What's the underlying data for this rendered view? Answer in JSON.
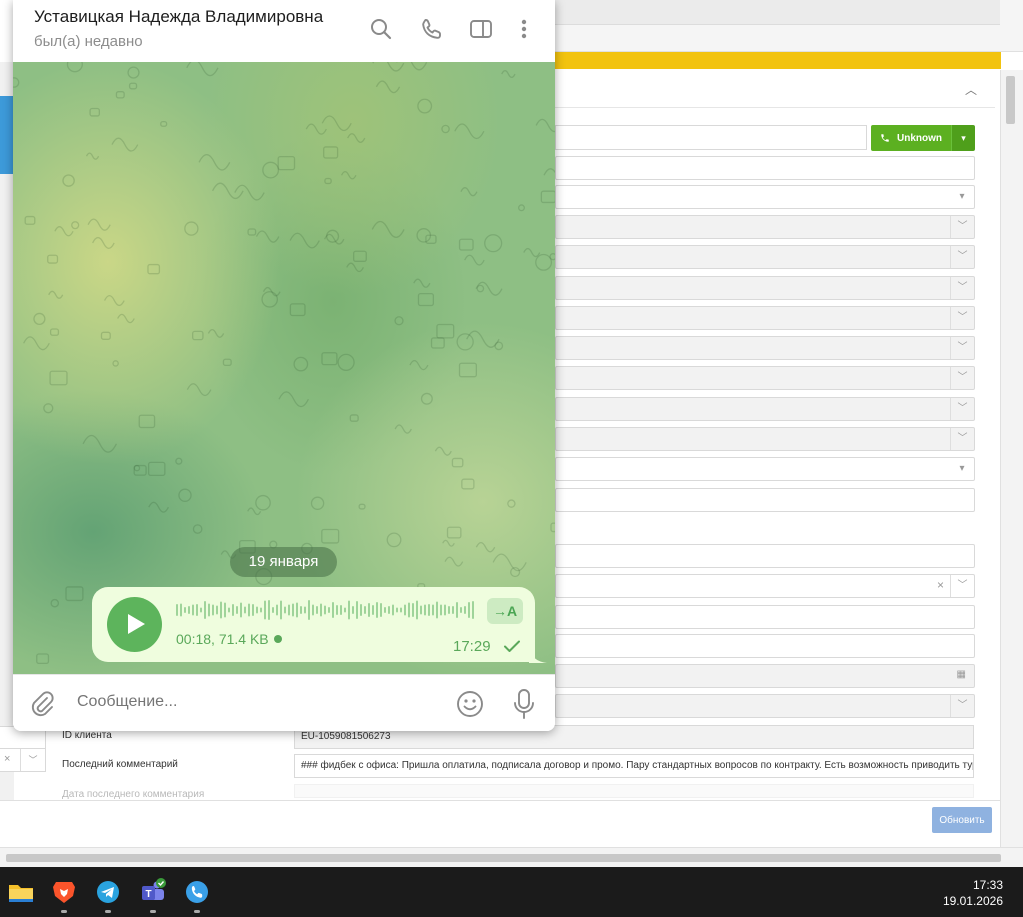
{
  "telegram": {
    "contact_name": "Уставицкая Надежда Владимировна",
    "contact_status": "был(а) недавно",
    "date_divider": "19 января",
    "voice_message": {
      "duration_size": "00:18, 71.4 KB",
      "time": "17:29",
      "transcribe_label": "→A"
    },
    "composer_placeholder": "Сообщение..."
  },
  "crm": {
    "call_button_label": "Unknown",
    "client_id_label": "ID клиента",
    "client_id_value": "EU-1059081506273",
    "last_comment_label": "Последний комментарий",
    "last_comment_value": "### фидбек с офиса: Пришла оплатила, подписала договор и промо. Пару стандартных вопросов по контракту. Есть возможность приводить турков на рум. Диапазо",
    "next_label_partial": "Дата последнего комментария",
    "update_button_label": "Обновить",
    "accent_color": "#5cb021",
    "banner_color": "#f2c30f"
  },
  "taskbar": {
    "apps": [
      "file-explorer",
      "brave-browser",
      "telegram",
      "teams",
      "phone-app"
    ],
    "time": "17:33",
    "date": "19.01.2026"
  }
}
